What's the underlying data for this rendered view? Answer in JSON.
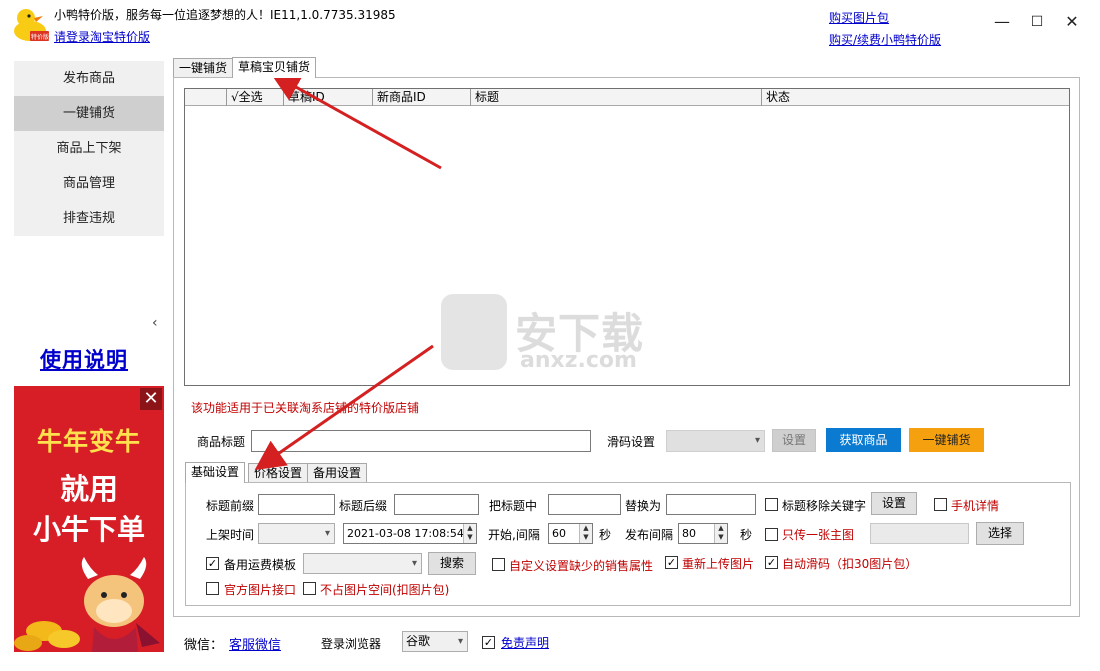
{
  "header": {
    "title": "小鸭特价版，服务每一位追逐梦想的人！IE11,1.0.7735.31985",
    "login_link": "请登录淘宝特价版",
    "buy_pics_link": "购买图片包",
    "buy_renew_link": "购买/续费小鸭特价版",
    "logo_badge": "特价版"
  },
  "window": {
    "minimize": "—",
    "maximize": "☐",
    "close": "✕"
  },
  "sidebar": {
    "items": [
      {
        "label": "发布商品"
      },
      {
        "label": "一键铺货"
      },
      {
        "label": "商品上下架"
      },
      {
        "label": "商品管理"
      },
      {
        "label": "排查违规"
      }
    ],
    "active_index": 1,
    "collapse_glyph": "‹",
    "usage_link": "使用说明"
  },
  "ad": {
    "line1": "牛年变牛",
    "line2": "就用",
    "line3": "小牛下单",
    "close_glyph": "✕"
  },
  "top_tabs": [
    "一键铺货",
    "草稿宝贝铺货"
  ],
  "grid": {
    "columns": [
      "",
      "√全选",
      "草稿ID",
      "新商品ID",
      "标题",
      "状态"
    ]
  },
  "watermark": {
    "text": "安下载",
    "sub": "anxz.com"
  },
  "notice": "该功能适用于已关联淘系店铺的特价版店铺",
  "form": {
    "title_label": "商品标题",
    "slip_label": "滑码设置",
    "set_button": "设置",
    "get_goods_button": "获取商品",
    "one_click_button": "一键铺货"
  },
  "settings_tabs": [
    "基础设置",
    "价格设置",
    "备用设置"
  ],
  "basic": {
    "prefix_label": "标题前缀",
    "suffix_label": "标题后缀",
    "replace_in_label": "把标题中",
    "replace_with_label": "替换为",
    "remove_keywords_label": "标题移除关键字",
    "remove_keywords_button": "设置",
    "mobile_detail_label": "手机详情",
    "shelf_time_label": "上架时间",
    "datetime_value": "2021-03-08 17:08:54",
    "start_interval_label": "开始,间隔",
    "start_interval_value": "60",
    "seconds_unit": "秒",
    "publish_interval_label": "发布间隔",
    "publish_interval_value": "80",
    "seconds_unit2": "秒",
    "only_main_image_label": "只传一张主图",
    "select_button": "选择",
    "backup_freight_label": "备用运费模板",
    "search_button": "搜索",
    "custom_attr_label": "自定义设置缺少的销售属性",
    "reupload_label": "重新上传图片",
    "auto_slip_label": "自动滑码（扣30图片包）",
    "official_image_label": "官方图片接口",
    "no_space_label": "不占图片空间(扣图片包)",
    "checked_glyph": "✓"
  },
  "footer": {
    "wechat_label": "微信：",
    "service_link": "客服微信",
    "browser_label": "登录浏览器",
    "browser_value": "谷歌",
    "disclaimer_link": "免责声明"
  },
  "colors": {
    "accent_blue": "#0b7ad1",
    "accent_orange": "#f5a10f",
    "warning_red": "#c00000",
    "link_blue": "#0000cc",
    "annotation_arrow": "#d42020"
  }
}
